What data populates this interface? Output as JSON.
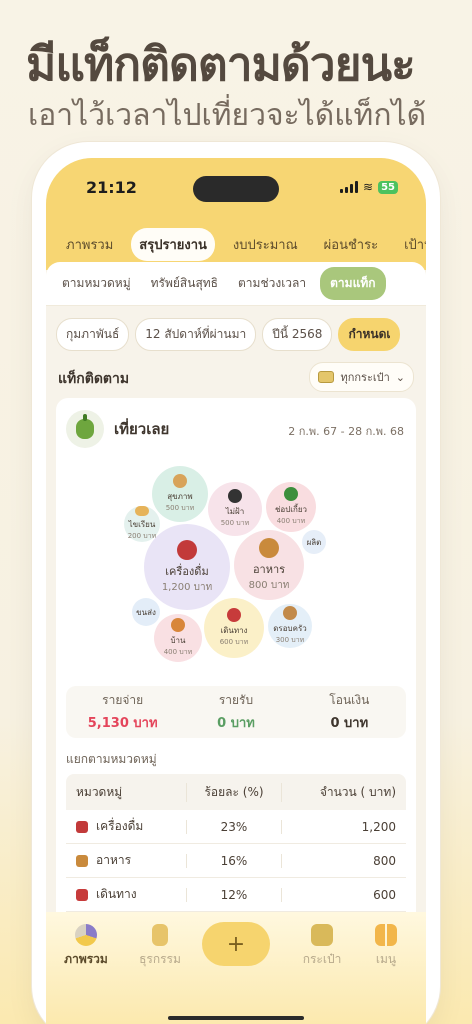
{
  "headline": "มีแท็กติดตามด้วยนะ",
  "subheadline": "เอาไว้เวลาไปเที่ยวจะได้แท็กได้",
  "status_bar": {
    "time": "21:12",
    "battery": "55"
  },
  "main_tabs": [
    {
      "label": "ภาพรวม"
    },
    {
      "label": "สรุปรายงาน"
    },
    {
      "label": "งบประมาณ"
    },
    {
      "label": "ผ่อนชำระ"
    },
    {
      "label": "เป้าหม"
    }
  ],
  "sub_tabs": [
    {
      "label": "ตามหมวดหมู่"
    },
    {
      "label": "ทรัพย์สินสุทธิ"
    },
    {
      "label": "ตามช่วงเวลา"
    },
    {
      "label": "ตามแท็ก"
    }
  ],
  "filters": [
    {
      "label": "กุมภาพันธ์"
    },
    {
      "label": "12 สัปดาห์ที่ผ่านมา"
    },
    {
      "label": "ปีนี้ 2568"
    },
    {
      "label": "กำหนดเ"
    }
  ],
  "section_title": "แท็กติดตาม",
  "wallet_select": {
    "label": "ทุกกระเป๋า",
    "chevron": "⌄"
  },
  "tag_card": {
    "icon": "bell-pepper-icon",
    "name": "เที่ยวเลย",
    "date_range": "2 ก.พ. 67 - 28 ก.พ. 68"
  },
  "bubbles": [
    {
      "name": "สุขภาพ",
      "amount": "500 บาท",
      "color": "#d9efe6",
      "icon_color": "#d8a35a"
    },
    {
      "name": "ไม่ฝ้า",
      "amount": "500 บาท",
      "color": "#f7e3ea",
      "icon_color": "#333333"
    },
    {
      "name": "ช่อปเกี้ยว",
      "amount": "400 บาท",
      "color": "#f9dde0",
      "icon_color": "#3d8f3d"
    },
    {
      "name": "ไขเรียน",
      "amount": "200 บาท",
      "color": "#e4f1ee",
      "icon_color": "#e6b35a"
    },
    {
      "name": "เครื่องดื่ม",
      "amount": "1,200 บาท",
      "color": "#e9e4f6",
      "icon_color": "#c23a3a"
    },
    {
      "name": "อาหาร",
      "amount": "800 บาท",
      "color": "#f8e1e4",
      "icon_color": "#c98a3c"
    },
    {
      "name": "ผลิต",
      "amount": "",
      "color": "#e6eef8",
      "icon_color": "#cfd8e6"
    },
    {
      "name": "ขนส่ง",
      "amount": "",
      "color": "#e3edf8",
      "icon_color": "#8fa9c9"
    },
    {
      "name": "บ้าน",
      "amount": "400 บาท",
      "color": "#f9e0e3",
      "icon_color": "#d8863a"
    },
    {
      "name": "เดินทาง",
      "amount": "600 บาท",
      "color": "#fbf0c8",
      "icon_color": "#c73b3b"
    },
    {
      "name": "ดรอบครัว",
      "amount": "300 บาท",
      "color": "#e4eff8",
      "icon_color": "#c28a4a"
    }
  ],
  "totals": [
    {
      "label": "รายจ่าย",
      "value": "5,130 บาท"
    },
    {
      "label": "รายรับ",
      "value": "0 บาท"
    },
    {
      "label": "โอนเงิน",
      "value": "0 บาท"
    }
  ],
  "breakdown_title": "แยกตามหมวดหมู่",
  "table": {
    "headers": [
      "หมวดหมู่",
      "ร้อยละ (%)",
      "จำนวน ( บาท)"
    ],
    "rows": [
      {
        "category": "เครื่องดื่ม",
        "percent": "23%",
        "amount": "1,200",
        "icon_color": "#c23a3a"
      },
      {
        "category": "อาหาร",
        "percent": "16%",
        "amount": "800",
        "icon_color": "#c98a3c"
      },
      {
        "category": "เดินทาง",
        "percent": "12%",
        "amount": "600",
        "icon_color": "#c73b3b"
      }
    ]
  },
  "tabbar": [
    {
      "label": "ภาพรวม",
      "icon": "pie-chart-icon"
    },
    {
      "label": "ธุรกรรม",
      "icon": "receipt-icon"
    },
    {
      "label": "กระเป๋า",
      "icon": "wallet-icon"
    },
    {
      "label": "เมนู",
      "icon": "grid-menu-icon"
    }
  ],
  "add_button": "+",
  "colors": {
    "accent_yellow": "#f7d673",
    "active_green": "#a9c77c",
    "expense_red": "#e4455b",
    "income_green": "#5a9e63"
  }
}
